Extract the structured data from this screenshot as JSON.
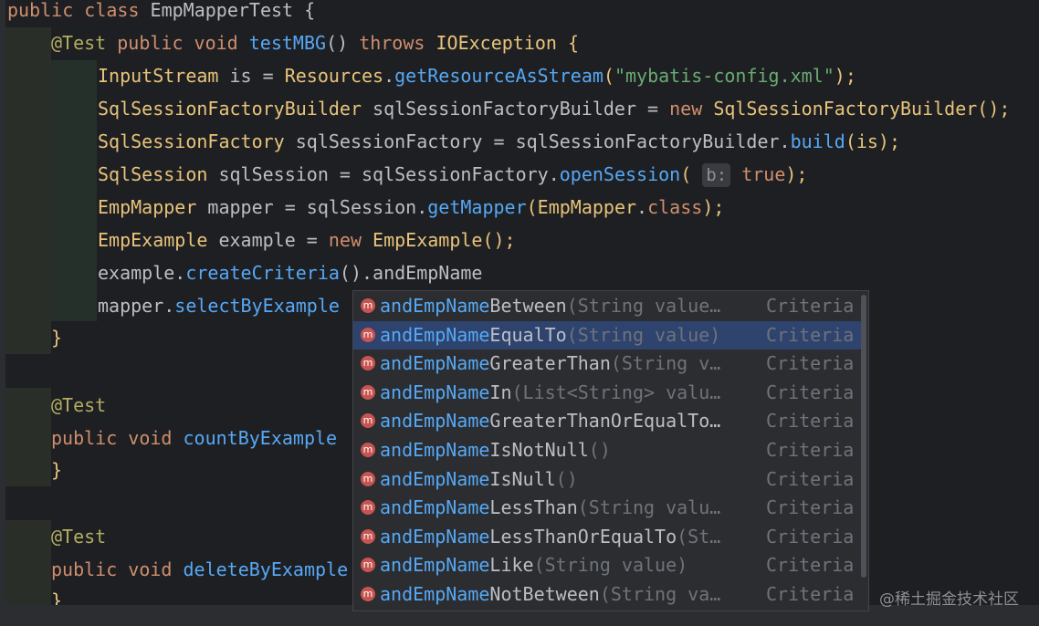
{
  "code": {
    "line1": {
      "kw": "public class ",
      "name": "EmpMapperTest",
      "brace": " {"
    },
    "line2": {
      "ann": "@Test",
      "kw1": " public ",
      "kw2": "void ",
      "method": "testMBG",
      "paren": "() ",
      "kw3": "throws ",
      "exc": "IOException",
      "brace": " {"
    },
    "line3": {
      "type": "InputStream",
      "var": " is = ",
      "cls": "Resources",
      "dot": ".",
      "method": "getResourceAsStream",
      "open": "(",
      "str": "\"mybatis-config.xml\"",
      "close": ");"
    },
    "line4": {
      "type": "SqlSessionFactoryBuilder",
      "var": " sqlSessionFactoryBuilder = ",
      "kw": "new ",
      "cls": "SqlSessionFactoryBuilder",
      "close": "();"
    },
    "line5": {
      "type": "SqlSessionFactory",
      "var": " sqlSessionFactory = sqlSessionFactoryBuilder.",
      "method": "build",
      "close": "(is);"
    },
    "line6": {
      "type": "SqlSession",
      "var": " sqlSession = sqlSessionFactory.",
      "method": "openSession",
      "open": "( ",
      "hint": "b:",
      "kw": " true",
      "close": ");"
    },
    "line7": {
      "type": "EmpMapper",
      "var": " mapper = sqlSession.",
      "method": "getMapper",
      "open": "(",
      "cls": "EmpMapper",
      "dot": ".",
      "kw": "class",
      "close": ");"
    },
    "line8": {
      "type": "EmpExample",
      "var": " example = ",
      "kw": "new ",
      "cls": "EmpExample",
      "close": "();"
    },
    "line9": {
      "var": "example.",
      "method": "createCriteria",
      "rest": "().andEmpName"
    },
    "line10": {
      "var": "mapper.",
      "method": "selectByExample"
    },
    "line11": {
      "brace": "}"
    },
    "line12": {
      "ann": "@Test"
    },
    "line13": {
      "kw1": "public ",
      "kw2": "void ",
      "method": "countByExample"
    },
    "line14": {
      "brace": "}"
    },
    "line15": {
      "ann": "@Test"
    },
    "line16": {
      "kw1": "public ",
      "kw2": "void ",
      "method": "deleteByExample"
    },
    "line17": {
      "brace": "}"
    }
  },
  "completion": {
    "icon_glyph": "m",
    "items": [
      {
        "prefix": "andEmpName",
        "rest": "Between",
        "sig": "(String value…",
        "type": "Criteria"
      },
      {
        "prefix": "andEmpName",
        "rest": "EqualTo",
        "sig": "(String value)",
        "type": "Criteria"
      },
      {
        "prefix": "andEmpName",
        "rest": "GreaterThan",
        "sig": "(String v…",
        "type": "Criteria"
      },
      {
        "prefix": "andEmpName",
        "rest": "In",
        "sig": "(List<String> valu…",
        "type": "Criteria"
      },
      {
        "prefix": "andEmpName",
        "rest": "GreaterThanOrEqualTo…",
        "sig": "",
        "type": "Criteria"
      },
      {
        "prefix": "andEmpName",
        "rest": "IsNotNull",
        "sig": "()",
        "type": "Criteria"
      },
      {
        "prefix": "andEmpName",
        "rest": "IsNull",
        "sig": "()",
        "type": "Criteria"
      },
      {
        "prefix": "andEmpName",
        "rest": "LessThan",
        "sig": "(String valu…",
        "type": "Criteria"
      },
      {
        "prefix": "andEmpName",
        "rest": "LessThanOrEqualTo",
        "sig": "(St…",
        "type": "Criteria"
      },
      {
        "prefix": "andEmpName",
        "rest": "Like",
        "sig": "(String value)",
        "type": "Criteria"
      },
      {
        "prefix": "andEmpName",
        "rest": "NotBetween",
        "sig": "(String va…",
        "type": "Criteria"
      }
    ]
  },
  "watermark": "@稀土掘金技术社区",
  "colors": {
    "background": "#1e1f22",
    "keyword": "#cf8e6d",
    "class": "#e8c37b",
    "method": "#56a8f5",
    "string": "#6aab73",
    "annotation": "#b3ae60",
    "popup_selection": "#2e436e",
    "method_icon": "#c75450"
  }
}
